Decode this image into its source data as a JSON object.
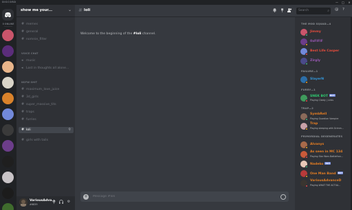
{
  "app": {
    "name": "DISCORD",
    "window_controls": [
      "—",
      "□",
      "✕"
    ]
  },
  "rail": {
    "online_label": "0 ONLINE",
    "servers": [
      {
        "name": "server-1",
        "color": "#c9556b"
      },
      {
        "name": "server-2",
        "color": "#5b2d7a"
      },
      {
        "name": "server-3",
        "color": "#e8b58a"
      },
      {
        "name": "server-4",
        "color": "#d9d4c8"
      },
      {
        "name": "server-5",
        "color": "#d9822b"
      },
      {
        "name": "server-6",
        "color": "#7289da"
      },
      {
        "name": "server-7",
        "color": "#3a3a3a"
      },
      {
        "name": "server-8",
        "color": "#6c3d8a"
      },
      {
        "name": "server-9",
        "color": "#1f1f1f"
      },
      {
        "name": "server-10",
        "color": "#c8c3c6"
      },
      {
        "name": "server-11",
        "color": "#1c1c1c"
      },
      {
        "name": "server-12",
        "color": "#3f6b2d"
      },
      {
        "name": "server-13",
        "color": "#2a2a2a"
      },
      {
        "name": "server-14",
        "color": "#5a4a3a"
      }
    ]
  },
  "guild": {
    "name": "show me your...",
    "chevron": "⌄"
  },
  "channels": {
    "top": [
      "memes",
      "general",
      "nomnie_filter"
    ],
    "cat1": "VOICE CHAT",
    "cat1_items": [
      "music",
      "Lost in thoughts all alone..."
    ],
    "cat2": "NSFW SHIT",
    "cat2_items": [
      "maximum_love_juice",
      "3d_girls",
      "super_massive_tits",
      "traps",
      "furries",
      "loli",
      "girls with tails"
    ],
    "active": "loli"
  },
  "user": {
    "name": "VariousAdva...",
    "tag": "#6839"
  },
  "chat": {
    "channel": "loli",
    "welcome_prefix": "Welcome to the beginning of the ",
    "welcome_channel": "#loli",
    "welcome_suffix": " channel.",
    "placeholder": "Message #loli",
    "search_placeholder": "Search"
  },
  "members": {
    "groups": [
      {
        "title": "THE MOD SQUAD—4",
        "items": [
          {
            "name": "Jimmy",
            "activity": "",
            "color": "#e74c3c",
            "avatar": "#c9556b",
            "bot": false
          },
          {
            "name": "0xFlFlF",
            "activity": "",
            "color": "#9b59b6",
            "avatar": "#6c3d8a",
            "bot": false
          },
          {
            "name": "Best Life Casper",
            "activity": "",
            "color": "#e74c3c",
            "avatar": "#7289da",
            "bot": false
          },
          {
            "name": "Zirgly",
            "activity": "",
            "color": "#9b59b6",
            "avatar": "#4a4a8a",
            "bot": false
          }
        ]
      },
      {
        "title": "FAILURE—1",
        "items": [
          {
            "name": "SlayerN",
            "activity": "",
            "color": "#3498db",
            "avatar": "#2c6ea8",
            "bot": false
          }
        ]
      },
      {
        "title": "FURRY—1",
        "items": [
          {
            "name": "SNEK BOT",
            "activity": "Playing Cleaty | Links",
            "color": "#2ecc71",
            "avatar": "#3f9a5c",
            "bot": true
          }
        ]
      },
      {
        "title": "TRAP—2",
        "items": [
          {
            "name": "SymbRell",
            "activity": "Playing Guardian Vampire",
            "color": "#e67e22",
            "avatar": "#8a6a5a",
            "bot": false
          },
          {
            "name": "Trap",
            "activity": "Playing sleeping with Grimm...",
            "color": "#e67e22",
            "avatar": "#c8a0a8",
            "bot": false
          }
        ]
      },
      {
        "title": "PRIMORDIAL DEGENERATES",
        "items": [
          {
            "name": "Alvanys",
            "activity": "",
            "color": "#e67e22",
            "avatar": "#a86a4a",
            "bot": false
          },
          {
            "name": "As seen in MC 134",
            "activity": "Playing Star Wars Battlefron...",
            "color": "#e67e22",
            "avatar": "#c95a3a",
            "bot": false
          },
          {
            "name": "Nadeko",
            "activity": "",
            "color": "#e67e22",
            "avatar": "#e8c8b8",
            "bot": true
          },
          {
            "name": "One Man Band",
            "activity": "",
            "color": "#e67e22",
            "avatar": "#b83a3a",
            "bot": true
          },
          {
            "name": "VariousAdvanceD",
            "activity": "Playing WHAT THE ACTUA...",
            "color": "#e67e22",
            "avatar": "#3a3530",
            "bot": false
          }
        ]
      }
    ]
  },
  "colors": {
    "online": "#43b581",
    "idle": "#faa61a",
    "dnd": "#f04747"
  }
}
